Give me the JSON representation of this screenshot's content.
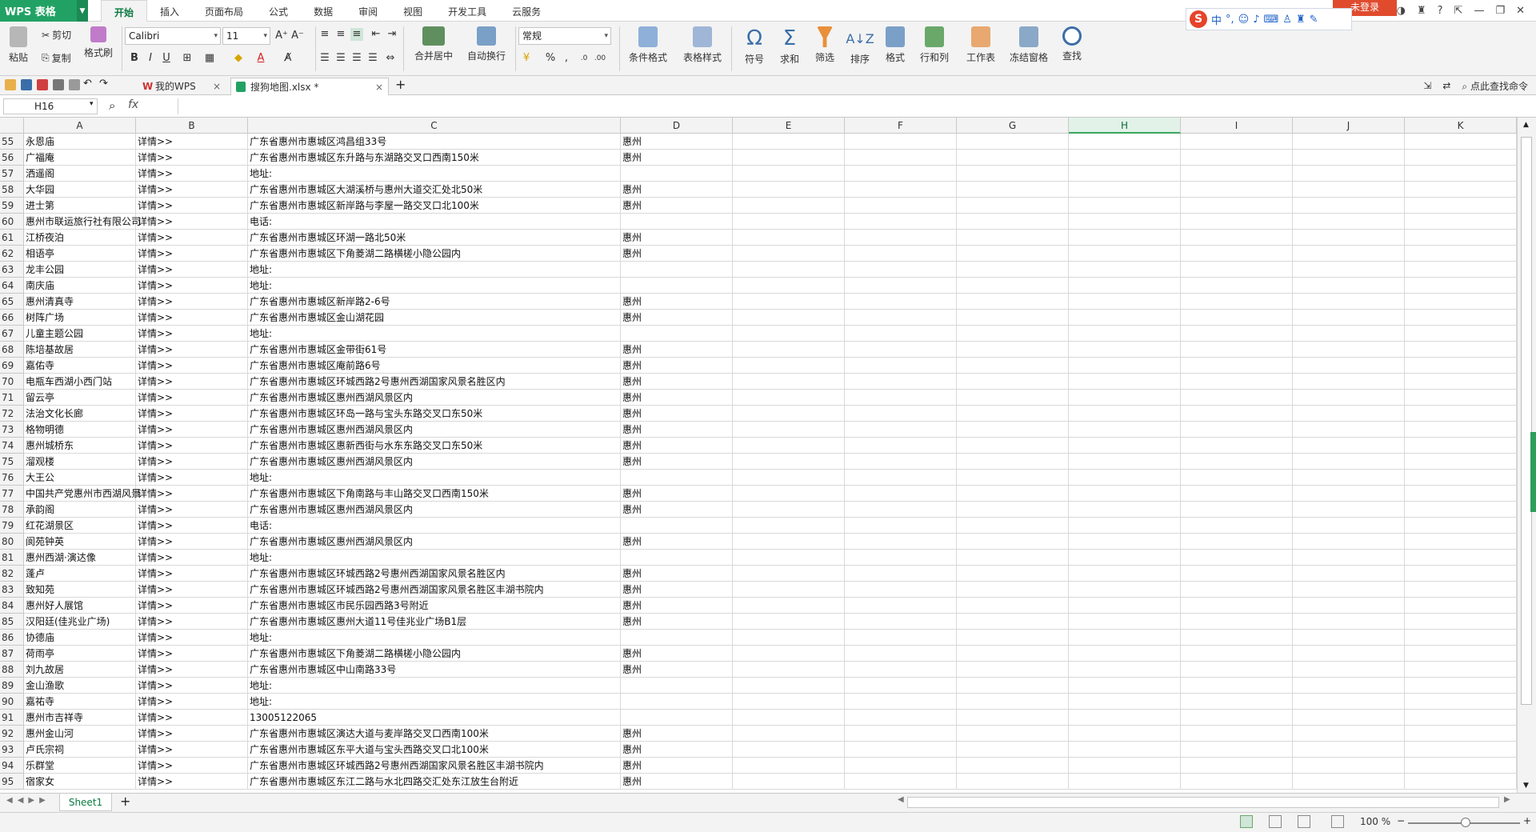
{
  "app": {
    "name": "WPS 表格",
    "login_label": "未登录"
  },
  "menu": [
    "开始",
    "插入",
    "页面布局",
    "公式",
    "数据",
    "审阅",
    "视图",
    "开发工具",
    "云服务"
  ],
  "ime": {
    "logo": "S",
    "mode": "中"
  },
  "ribbon": {
    "paste": "粘贴",
    "cut": "剪切",
    "copy": "复制",
    "format_painter": "格式刷",
    "font_name": "Calibri",
    "font_size": "11",
    "merge": "合并居中",
    "wrap": "自动换行",
    "num_format": "常规",
    "cond_format": "条件格式",
    "table_style": "表格样式",
    "symbol": "符号",
    "sum": "求和",
    "filter": "筛选",
    "sort": "排序",
    "format": "格式",
    "rowcol": "行和列",
    "worksheet": "工作表",
    "freeze": "冻结窗格",
    "find": "查找"
  },
  "tabs": {
    "wps_home": "我的WPS",
    "doc": "搜狗地图.xlsx *",
    "find_cmd": "点此查找命令"
  },
  "formula_bar": {
    "cell_ref": "H16",
    "fx": "fx",
    "value": ""
  },
  "columns": [
    "A",
    "B",
    "C",
    "D",
    "E",
    "F",
    "G",
    "H",
    "I",
    "J",
    "K"
  ],
  "rows": [
    {
      "n": "55",
      "a": "永恩庙",
      "b": "详情>>",
      "c": "广东省惠州市惠城区鸿昌组33号",
      "d": "惠州"
    },
    {
      "n": "56",
      "a": "广福庵",
      "b": "详情>>",
      "c": "广东省惠州市惠城区东升路与东湖路交叉口西南150米",
      "d": "惠州"
    },
    {
      "n": "57",
      "a": "洒遥阁",
      "b": "详情>>",
      "c": "地址:",
      "d": ""
    },
    {
      "n": "58",
      "a": "大华园",
      "b": "详情>>",
      "c": "广东省惠州市惠城区大湖溪桥与惠州大道交汇处北50米",
      "d": "惠州"
    },
    {
      "n": "59",
      "a": "进士第",
      "b": "详情>>",
      "c": "广东省惠州市惠城区新岸路与李屋一路交叉口北100米",
      "d": "惠州"
    },
    {
      "n": "60",
      "a": "惠州市联运旅行社有限公司",
      "b": "详情>>",
      "c": "电话:",
      "d": ""
    },
    {
      "n": "61",
      "a": "江桥夜泊",
      "b": "详情>>",
      "c": "广东省惠州市惠城区环湖一路北50米",
      "d": "惠州"
    },
    {
      "n": "62",
      "a": "相语亭",
      "b": "详情>>",
      "c": "广东省惠州市惠城区下角菱湖二路横槎小隐公园内",
      "d": "惠州"
    },
    {
      "n": "63",
      "a": "龙丰公园",
      "b": "详情>>",
      "c": "地址:",
      "d": ""
    },
    {
      "n": "64",
      "a": "南庆庙",
      "b": "详情>>",
      "c": "地址:",
      "d": ""
    },
    {
      "n": "65",
      "a": "惠州清真寺",
      "b": "详情>>",
      "c": "广东省惠州市惠城区新岸路2-6号",
      "d": "惠州"
    },
    {
      "n": "66",
      "a": "树阵广场",
      "b": "详情>>",
      "c": "广东省惠州市惠城区金山湖花园",
      "d": "惠州"
    },
    {
      "n": "67",
      "a": "儿童主题公园",
      "b": "详情>>",
      "c": "地址:",
      "d": ""
    },
    {
      "n": "68",
      "a": "陈培基故居",
      "b": "详情>>",
      "c": "广东省惠州市惠城区金带街61号",
      "d": "惠州"
    },
    {
      "n": "69",
      "a": "嘉佑寺",
      "b": "详情>>",
      "c": "广东省惠州市惠城区庵前路6号",
      "d": "惠州"
    },
    {
      "n": "70",
      "a": "电瓶车西湖小西门站",
      "b": "详情>>",
      "c": "广东省惠州市惠城区环城西路2号惠州西湖国家风景名胜区内",
      "d": "惠州"
    },
    {
      "n": "71",
      "a": "留云亭",
      "b": "详情>>",
      "c": "广东省惠州市惠城区惠州西湖风景区内",
      "d": "惠州"
    },
    {
      "n": "72",
      "a": "法治文化长廊",
      "b": "详情>>",
      "c": "广东省惠州市惠城区环岛一路与宝头东路交叉口东50米",
      "d": "惠州"
    },
    {
      "n": "73",
      "a": "格物明德",
      "b": "详情>>",
      "c": "广东省惠州市惠城区惠州西湖风景区内",
      "d": "惠州"
    },
    {
      "n": "74",
      "a": "惠州城桥东",
      "b": "详情>>",
      "c": "广东省惠州市惠城区惠新西街与水东东路交叉口东50米",
      "d": "惠州"
    },
    {
      "n": "75",
      "a": "溜观楼",
      "b": "详情>>",
      "c": "广东省惠州市惠城区惠州西湖风景区内",
      "d": "惠州"
    },
    {
      "n": "76",
      "a": "大王公",
      "b": "详情>>",
      "c": "地址:",
      "d": ""
    },
    {
      "n": "77",
      "a": "中国共产党惠州市西湖风景",
      "b": "详情>>",
      "c": "广东省惠州市惠城区下角南路与丰山路交叉口西南150米",
      "d": "惠州"
    },
    {
      "n": "78",
      "a": "承韵阁",
      "b": "详情>>",
      "c": "广东省惠州市惠城区惠州西湖风景区内",
      "d": "惠州"
    },
    {
      "n": "79",
      "a": "红花湖景区",
      "b": "详情>>",
      "c": "电话:",
      "d": ""
    },
    {
      "n": "80",
      "a": "阆苑钟英",
      "b": "详情>>",
      "c": "广东省惠州市惠城区惠州西湖风景区内",
      "d": "惠州"
    },
    {
      "n": "81",
      "a": "惠州西湖·演达像",
      "b": "详情>>",
      "c": "地址:",
      "d": ""
    },
    {
      "n": "82",
      "a": "蓬卢",
      "b": "详情>>",
      "c": "广东省惠州市惠城区环城西路2号惠州西湖国家风景名胜区内",
      "d": "惠州"
    },
    {
      "n": "83",
      "a": "致知苑",
      "b": "详情>>",
      "c": "广东省惠州市惠城区环城西路2号惠州西湖国家风景名胜区丰湖书院内",
      "d": "惠州"
    },
    {
      "n": "84",
      "a": "惠州好人展馆",
      "b": "详情>>",
      "c": "广东省惠州市惠城区市民乐园西路3号附近",
      "d": "惠州"
    },
    {
      "n": "85",
      "a": "汉阳廷(佳兆业广场)",
      "b": "详情>>",
      "c": "广东省惠州市惠城区惠州大道11号佳兆业广场B1层",
      "d": "惠州"
    },
    {
      "n": "86",
      "a": "协德庙",
      "b": "详情>>",
      "c": "地址:",
      "d": ""
    },
    {
      "n": "87",
      "a": "荷雨亭",
      "b": "详情>>",
      "c": "广东省惠州市惠城区下角菱湖二路横槎小隐公园内",
      "d": "惠州"
    },
    {
      "n": "88",
      "a": "刘九故居",
      "b": "详情>>",
      "c": "广东省惠州市惠城区中山南路33号",
      "d": "惠州"
    },
    {
      "n": "89",
      "a": "金山渔歌",
      "b": "详情>>",
      "c": "地址:",
      "d": ""
    },
    {
      "n": "90",
      "a": "嘉祐寺",
      "b": "详情>>",
      "c": "地址:",
      "d": ""
    },
    {
      "n": "91",
      "a": "惠州市吉祥寺",
      "b": "详情>>",
      "c": "13005122065",
      "d": ""
    },
    {
      "n": "92",
      "a": "惠州金山河",
      "b": "详情>>",
      "c": "广东省惠州市惠城区演达大道与麦岸路交叉口西南100米",
      "d": "惠州"
    },
    {
      "n": "93",
      "a": "卢氏宗祠",
      "b": "详情>>",
      "c": "广东省惠州市惠城区东平大道与宝头西路交叉口北100米",
      "d": "惠州"
    },
    {
      "n": "94",
      "a": "乐群堂",
      "b": "详情>>",
      "c": "广东省惠州市惠城区环城西路2号惠州西湖国家风景名胜区丰湖书院内",
      "d": "惠州"
    },
    {
      "n": "95",
      "a": "宿家女",
      "b": "详情>>",
      "c": "广东省惠州市惠城区东江二路与水北四路交汇处东江放生台附近",
      "d": "惠州"
    }
  ],
  "sheet_tab": "Sheet1",
  "status": {
    "zoom": "100 %"
  },
  "colors": {
    "accent": "#21a264",
    "login": "#e04b2e",
    "selected_col": "#3aa660"
  }
}
